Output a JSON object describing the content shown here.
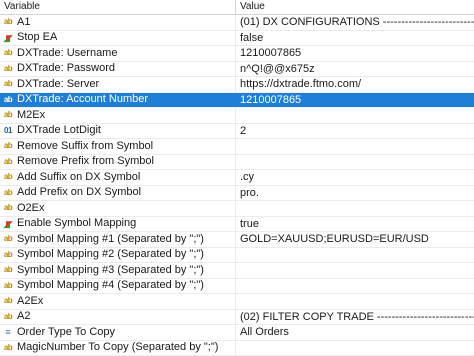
{
  "header": {
    "variable": "Variable",
    "value": "Value"
  },
  "rows": [
    {
      "icon": "ab-string-icon",
      "type": "ab",
      "label": "A1",
      "value": "(01) DX CONFIGURATIONS ------------------------------------------------"
    },
    {
      "icon": "bool-icon",
      "type": "bool",
      "label": "Stop EA",
      "value": "false"
    },
    {
      "icon": "ab-string-icon",
      "type": "ab",
      "label": "DXTrade: Username",
      "value": "1210007865"
    },
    {
      "icon": "ab-string-icon",
      "type": "ab",
      "label": "DXTrade: Password",
      "value": "n^Q!@@x675z"
    },
    {
      "icon": "ab-string-icon",
      "type": "ab",
      "label": "DXTrade: Server",
      "value": "https://dxtrade.ftmo.com/"
    },
    {
      "icon": "ab-string-icon",
      "type": "ab",
      "label": "DXTrade: Account Number",
      "value": "1210007865",
      "selected": true
    },
    {
      "icon": "ab-string-icon",
      "type": "ab",
      "label": "M2Ex",
      "value": ""
    },
    {
      "icon": "number-icon",
      "type": "num",
      "label": "DXTrade LotDigit",
      "value": "2"
    },
    {
      "icon": "ab-string-icon",
      "type": "ab",
      "label": "Remove Suffix from Symbol",
      "value": ""
    },
    {
      "icon": "ab-string-icon",
      "type": "ab",
      "label": "Remove Prefix from Symbol",
      "value": ""
    },
    {
      "icon": "ab-string-icon",
      "type": "ab",
      "label": "Add Suffix on DX Symbol",
      "value": ".cy"
    },
    {
      "icon": "ab-string-icon",
      "type": "ab",
      "label": "Add Prefix on DX Symbol",
      "value": "pro."
    },
    {
      "icon": "ab-string-icon",
      "type": "ab",
      "label": "O2Ex",
      "value": ""
    },
    {
      "icon": "bool-icon",
      "type": "bool",
      "label": "Enable Symbol Mapping",
      "value": "true"
    },
    {
      "icon": "ab-string-icon",
      "type": "ab",
      "label": "Symbol Mapping #1 (Separated by \";\")",
      "value": "GOLD=XAUUSD;EURUSD=EUR/USD"
    },
    {
      "icon": "ab-string-icon",
      "type": "ab",
      "label": "Symbol Mapping #2 (Separated by \";\")",
      "value": ""
    },
    {
      "icon": "ab-string-icon",
      "type": "ab",
      "label": "Symbol Mapping #3 (Separated by \";\")",
      "value": ""
    },
    {
      "icon": "ab-string-icon",
      "type": "ab",
      "label": "Symbol Mapping #4 (Separated by \";\")",
      "value": ""
    },
    {
      "icon": "ab-string-icon",
      "type": "ab",
      "label": "A2Ex",
      "value": ""
    },
    {
      "icon": "ab-string-icon",
      "type": "ab",
      "label": "A2",
      "value": "(02) FILTER COPY TRADE ---------------------------------------------"
    },
    {
      "icon": "enum-icon",
      "type": "enum",
      "label": "Order Type To Copy",
      "value": "All Orders"
    },
    {
      "icon": "ab-string-icon",
      "type": "ab",
      "label": "MagicNumber To Copy (Separated by \";\")",
      "value": ""
    }
  ]
}
